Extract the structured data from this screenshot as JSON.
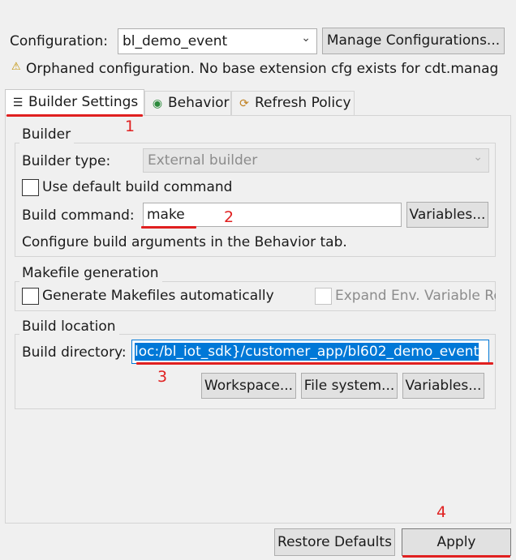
{
  "configuration": {
    "label": "Configuration:",
    "selected": "bl_demo_event",
    "manage_label": "Manage Configurations...",
    "warning_text": "Orphaned configuration. No base extension cfg exists for cdt.manag"
  },
  "tabs": [
    {
      "label": "Builder Settings",
      "icon": "list-icon"
    },
    {
      "label": "Behavior",
      "icon": "radio-dot-icon"
    },
    {
      "label": "Refresh Policy",
      "icon": "refresh-icon"
    }
  ],
  "builder": {
    "title": "Builder",
    "type_label": "Builder type:",
    "type_value": "External builder",
    "use_default_label": "Use default build command",
    "use_default_checked": false,
    "command_label": "Build command:",
    "command_value": "make",
    "variables_label": "Variables...",
    "hint": "Configure build arguments in the Behavior tab."
  },
  "makefile": {
    "title": "Makefile generation",
    "generate_label": "Generate Makefiles automatically",
    "generate_checked": false,
    "expand_label": "Expand Env. Variable Re",
    "expand_checked": false
  },
  "location": {
    "title": "Build location",
    "dir_label": "Build directory:",
    "dir_value": "loc:/bl_iot_sdk}/customer_app/bl602_demo_event",
    "workspace_label": "Workspace...",
    "filesystem_label": "File system...",
    "variables_label": "Variables..."
  },
  "footer": {
    "restore_label": "Restore Defaults",
    "apply_label": "Apply"
  },
  "annotations": [
    "1",
    "2",
    "3",
    "4"
  ],
  "colors": {
    "annotation": "#e02020",
    "selection": "#0078d7",
    "background": "#f0f0f0"
  }
}
